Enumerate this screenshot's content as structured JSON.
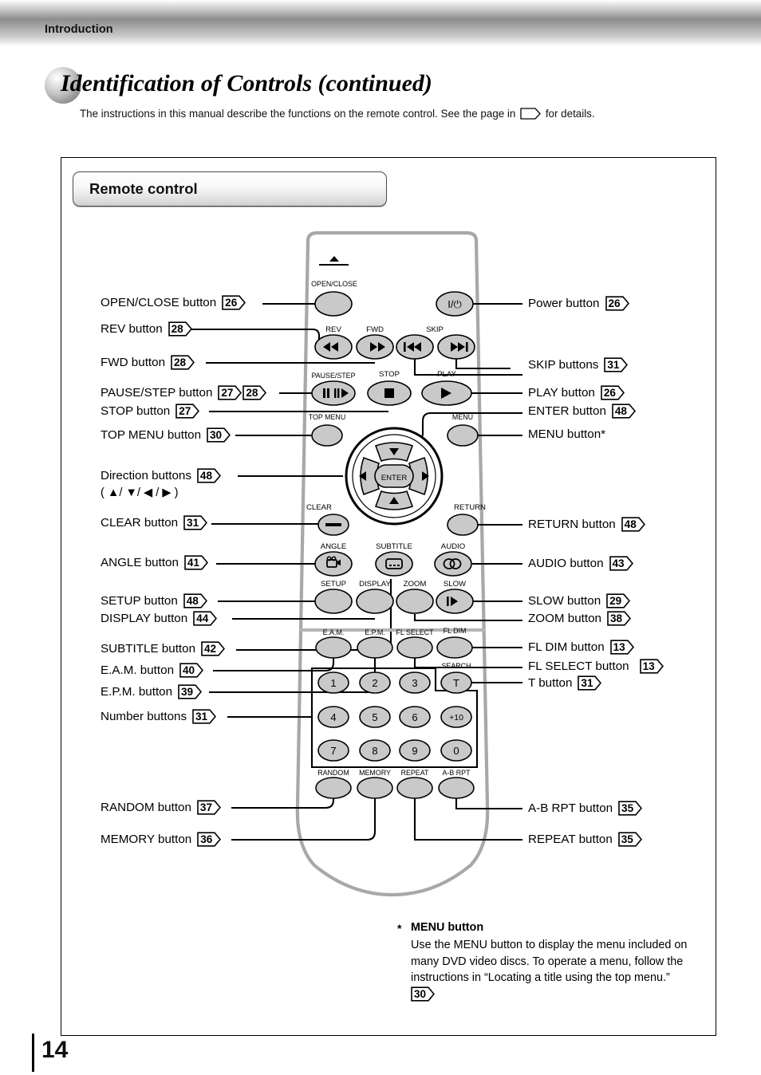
{
  "running_head": "Introduction",
  "page_title": "Identification of Controls (continued)",
  "subtitle_part1": "The instructions in this manual describe the functions on the remote control. See the page in",
  "subtitle_part2": "for details.",
  "section_heading": "Remote control",
  "page_number": "14",
  "callouts_left": [
    {
      "label": "OPEN/CLOSE button",
      "pages": [
        "26"
      ]
    },
    {
      "label": "REV button",
      "pages": [
        "28"
      ]
    },
    {
      "label": "FWD button",
      "pages": [
        "28"
      ]
    },
    {
      "label": "PAUSE/STEP button",
      "pages": [
        "27",
        "28"
      ]
    },
    {
      "label": "STOP button",
      "pages": [
        "27"
      ]
    },
    {
      "label": "TOP MENU button",
      "pages": [
        "30"
      ]
    },
    {
      "label": "Direction buttons",
      "pages": [
        "48"
      ],
      "sub": "( ▲/ ▼/ ◀ / ▶ )"
    },
    {
      "label": "CLEAR button",
      "pages": [
        "31"
      ]
    },
    {
      "label": "ANGLE button",
      "pages": [
        "41"
      ]
    },
    {
      "label": "SETUP button",
      "pages": [
        "48"
      ]
    },
    {
      "label": "DISPLAY button",
      "pages": [
        "44"
      ]
    },
    {
      "label": "SUBTITLE button",
      "pages": [
        "42"
      ]
    },
    {
      "label": "E.A.M. button",
      "pages": [
        "40"
      ]
    },
    {
      "label": "E.P.M. button",
      "pages": [
        "39"
      ]
    },
    {
      "label": "Number buttons",
      "pages": [
        "31"
      ]
    },
    {
      "label": "RANDOM button",
      "pages": [
        "37"
      ]
    },
    {
      "label": "MEMORY button",
      "pages": [
        "36"
      ]
    }
  ],
  "callouts_right": [
    {
      "label": "Power button",
      "pages": [
        "26"
      ]
    },
    {
      "label": "SKIP buttons",
      "pages": [
        "31"
      ]
    },
    {
      "label": "PLAY button",
      "pages": [
        "26"
      ]
    },
    {
      "label": "ENTER button",
      "pages": [
        "48"
      ]
    },
    {
      "label": "MENU button*",
      "pages": []
    },
    {
      "label": "RETURN button",
      "pages": [
        "48"
      ]
    },
    {
      "label": "AUDIO button",
      "pages": [
        "43"
      ]
    },
    {
      "label": "SLOW button",
      "pages": [
        "29"
      ]
    },
    {
      "label": "ZOOM button",
      "pages": [
        "38"
      ]
    },
    {
      "label": "FL DIM button",
      "pages": [
        "13"
      ]
    },
    {
      "label": "FL SELECT button",
      "pages": [
        "13"
      ]
    },
    {
      "label": "T button",
      "pages": [
        "31"
      ]
    },
    {
      "label": "A-B RPT button",
      "pages": [
        "35"
      ]
    },
    {
      "label": "REPEAT button",
      "pages": [
        "35"
      ]
    }
  ],
  "remote_labels": {
    "open_close": "OPEN/CLOSE",
    "power": "I/⏻",
    "rev": "REV",
    "fwd": "FWD",
    "skip": "SKIP",
    "pause_step": "PAUSE/STEP",
    "stop": "STOP",
    "play": "PLAY",
    "top_menu": "TOP MENU",
    "menu": "MENU",
    "enter": "ENTER",
    "clear": "CLEAR",
    "return": "RETURN",
    "angle": "ANGLE",
    "subtitle": "SUBTITLE",
    "audio": "AUDIO",
    "setup": "SETUP",
    "display": "DISPLAY",
    "zoom": "ZOOM",
    "slow": "SLOW",
    "eam": "E.A.M.",
    "epm": "E.P.M.",
    "fl_select": "FL SELECT",
    "fl_dim": "FL DIM",
    "search": "SEARCH",
    "search_key": "T",
    "random": "RANDOM",
    "memory": "MEMORY",
    "repeat": "REPEAT",
    "ab_rpt": "A-B RPT",
    "numbers": [
      "1",
      "2",
      "3",
      "4",
      "5",
      "6",
      "7",
      "8",
      "9",
      "+10",
      "0"
    ]
  },
  "footnote": {
    "star": "*",
    "heading": "MENU button",
    "body": "Use the MENU button to display the menu included on many DVD video discs. To operate a menu, follow the instructions in “Locating a title using the top menu.”",
    "page": "30"
  },
  "colors": {
    "button_fill": "#c9c9c9",
    "remote_outline": "#a8a8a8",
    "line": "#000000",
    "band_dark": "#8d8d8d"
  }
}
